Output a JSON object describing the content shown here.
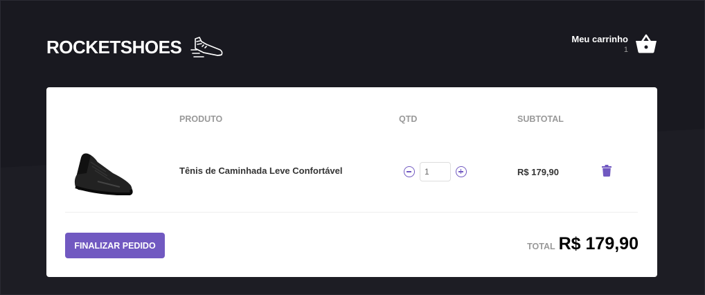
{
  "header": {
    "logo_text": "ROCKETSHOES",
    "cart_title": "Meu carrinho",
    "cart_count": "1"
  },
  "table": {
    "columns": [
      "PRODUTO",
      "QTD",
      "SUBTOTAL"
    ],
    "rows": [
      {
        "title": "Tênis de Caminhada Leve Confortável",
        "quantity": "1",
        "subtotal": "R$ 179,90"
      }
    ]
  },
  "footer": {
    "checkout_label": "FINALIZAR PEDIDO",
    "total_label": "TOTAL",
    "total_value": "R$ 179,90"
  },
  "colors": {
    "background": "#191920",
    "accent": "#7159c1",
    "panel": "#ffffff"
  },
  "icons": [
    "shoe-logo-icon",
    "basket-icon",
    "minus-circle-icon",
    "plus-circle-icon",
    "trash-icon"
  ]
}
